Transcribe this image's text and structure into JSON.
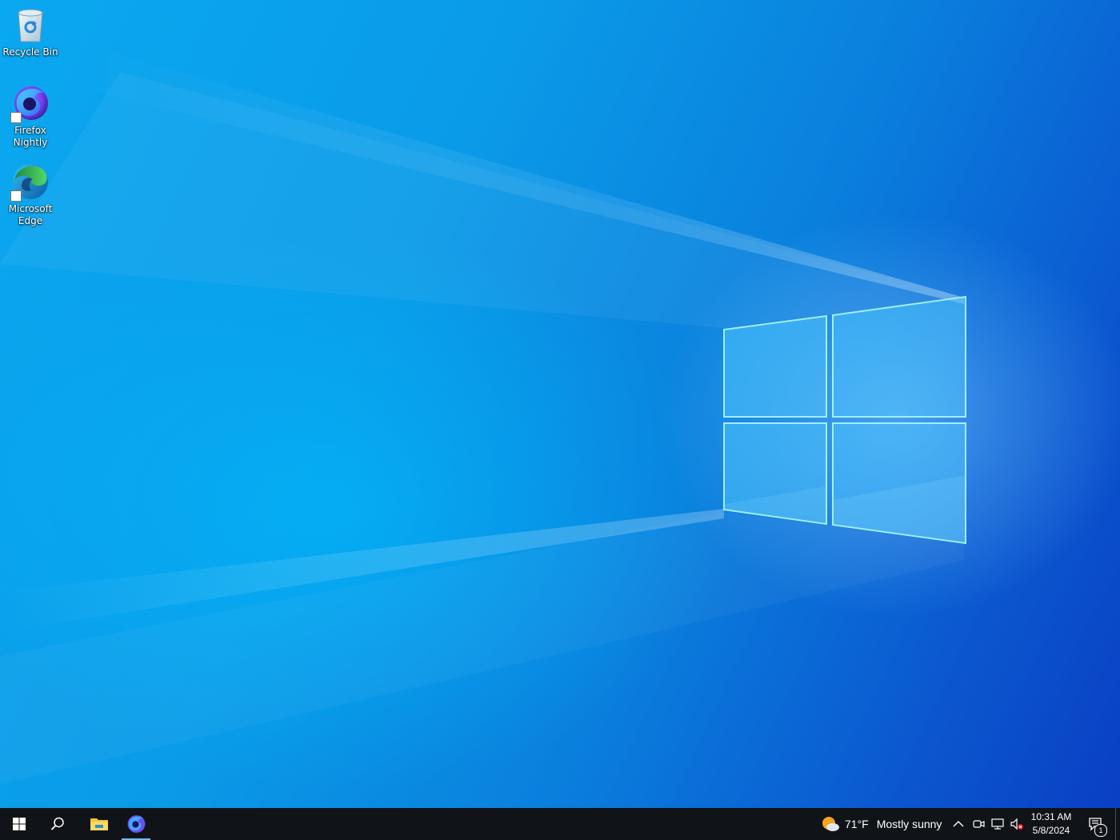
{
  "desktop": {
    "icons": [
      {
        "label": "Recycle Bin",
        "icon": "recycle-bin-icon"
      },
      {
        "label": "Firefox\nNightly",
        "icon": "firefox-nightly-icon"
      },
      {
        "label": "Microsoft\nEdge",
        "icon": "microsoft-edge-icon"
      }
    ],
    "wallpaper": {
      "accent": "#0a9be8",
      "deep": "#0a3fc4",
      "logo": "windows-logo"
    }
  },
  "taskbar": {
    "background": "#101317",
    "start_icon": "windows-start-icon",
    "search_icon": "search-icon",
    "pinned": [
      {
        "name": "file-explorer",
        "icon": "folder-icon",
        "active": false
      },
      {
        "name": "firefox-nightly",
        "icon": "firefox-nightly-icon",
        "active": true
      }
    ],
    "weather": {
      "temp": "71°F",
      "condition": "Mostly sunny",
      "icon": "partly-sunny-icon"
    },
    "tray_icons": [
      "chevron-up-icon",
      "meet-now-icon",
      "network-icon",
      "volume-muted-icon"
    ],
    "clock": {
      "time": "10:31 AM",
      "date": "5/8/2024"
    },
    "notifications": {
      "count": "1",
      "icon": "action-center-icon"
    }
  }
}
